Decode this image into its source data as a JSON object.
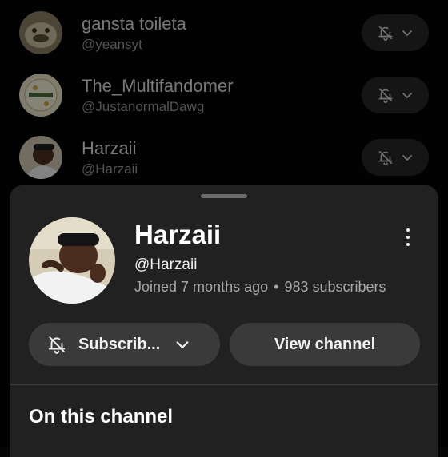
{
  "subscriptions": [
    {
      "name": "gansta toileta",
      "handle": "@yeansyt",
      "notification_icon": "bell-off-icon"
    },
    {
      "name": "The_Multifandomer",
      "handle": "@JustanormalDawg",
      "notification_icon": "bell-off-icon"
    },
    {
      "name": "Harzaii",
      "handle": "@Harzaii",
      "notification_icon": "bell-off-icon"
    }
  ],
  "sheet": {
    "channel_name": "Harzaii",
    "channel_handle": "@Harzaii",
    "joined": "Joined 7 months ago",
    "separator": "•",
    "subscribers": "983 subscribers",
    "subscribe_label": "Subscrib...",
    "view_channel_label": "View channel",
    "section_title": "On this channel"
  },
  "colors": {
    "background": "#050505",
    "sheet": "#212121",
    "button": "#3a3a3a",
    "secondary_text": "#a8a8a8"
  }
}
